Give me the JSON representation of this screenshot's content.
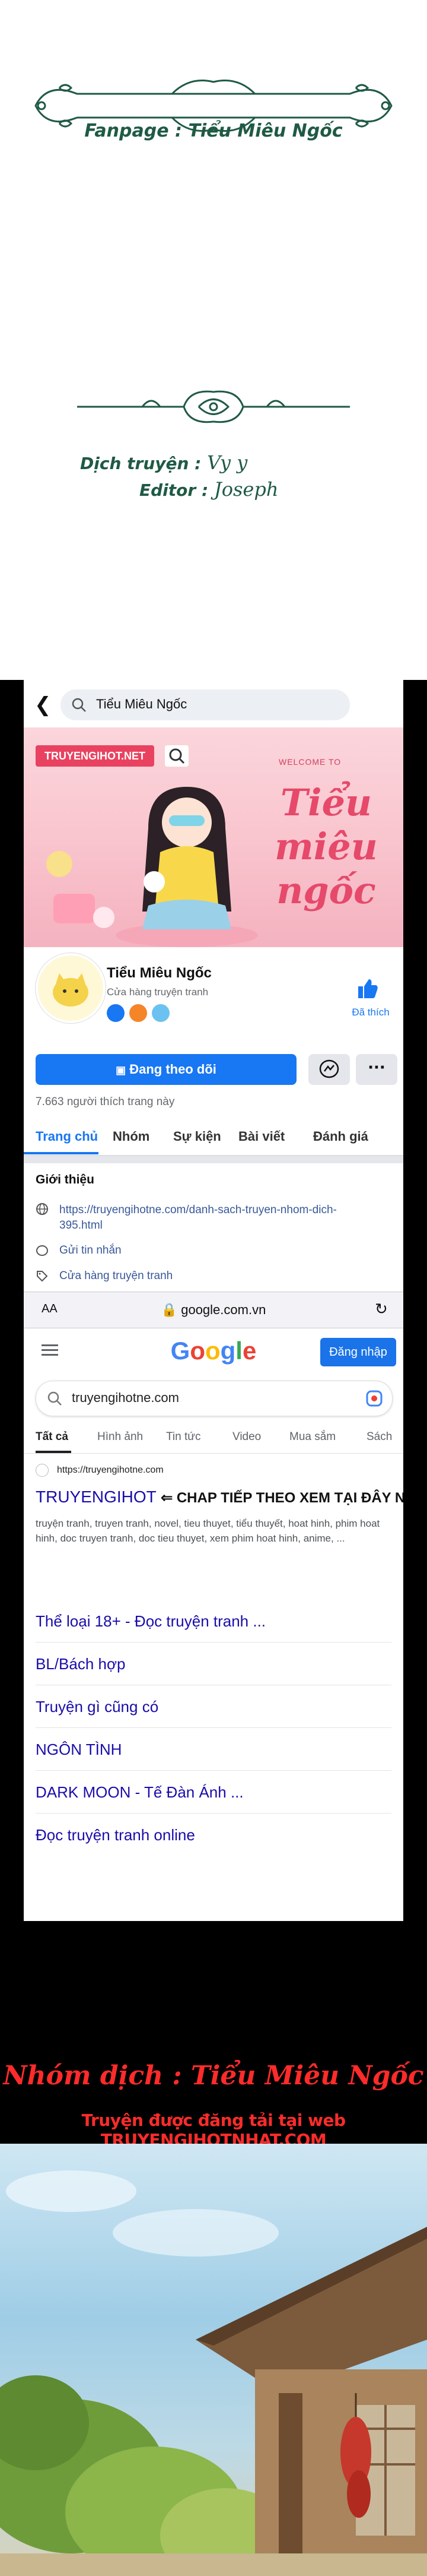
{
  "credits": {
    "fanpage": "Fanpage : Tiểu Miêu Ngốc",
    "translator_label": "Dịch truyện :",
    "translator_name": "Vy y",
    "editor_label": "Editor :",
    "editor_name": "Joseph"
  },
  "facebook": {
    "search_text": "Tiểu Miêu Ngốc",
    "cover_site_label": "TRUYENGIHOT.NET",
    "cover_welcome": "WELCOME TO",
    "cover_title": "Tiểu miêu ngốc",
    "page_name": "Tiểu Miêu Ngốc",
    "category": "Cửa hàng truyện tranh",
    "liked_label": "Đã thích",
    "follow_label": "Đang theo dõi",
    "more_label": "···",
    "likes_count": "7.663 người thích trang này",
    "tabs": [
      "Trang chủ",
      "Nhóm",
      "Sự kiện",
      "Bài viết",
      "Đánh giá"
    ],
    "intro_title": "Giới thiệu",
    "intro_link": "https://truyengihotne.com/danh-sach-truyen-nhom-dich-395.html",
    "send_message": "Gửi tin nhắn",
    "shop": "Cửa hàng truyện tranh"
  },
  "safari": {
    "aa": "AA",
    "url": "google.com.vn"
  },
  "google": {
    "logo": "Google",
    "signin": "Đăng nhập",
    "query": "truyengihotne.com",
    "tabs": [
      "Tất cả",
      "Hình ảnh",
      "Tin tức",
      "Video",
      "Mua sắm",
      "Sách"
    ],
    "result_site": "https://truyengihotne.com",
    "result_title": "TRUYENGIHOT",
    "result_annotation": "⇐ CHAP TIẾP THEO XEM TẠI ĐÂY NHA",
    "result_desc": "truyện tranh, truyen tranh, novel, tieu thuyet, tiểu thuyết, hoat hinh, phim hoat hinh, doc truyen tranh, doc tieu thuyet, xem phim hoat hinh, anime, ...",
    "sub_links": [
      "Thể loại 18+ - Đọc truyện tranh ...",
      "BL/Bách hợp",
      "Truyện gì cũng có",
      "NGÔN TÌNH",
      "DARK MOON - Tế Đàn Ánh ...",
      "Đọc truyện tranh online"
    ],
    "colors": {
      "blue": "#4285F4",
      "red": "#EA4335",
      "yellow": "#FBBC05",
      "green": "#34A853"
    }
  },
  "comic": {
    "group": "Nhóm dịch : Tiểu Miêu Ngốc",
    "posted": "Truyện được đăng tải tại web TRUYENGIHOTNHAT.COM"
  },
  "colors": {
    "credit_green": "#1f5a44",
    "fb_blue": "#1877f2",
    "red_text": "#ff2b2b"
  }
}
